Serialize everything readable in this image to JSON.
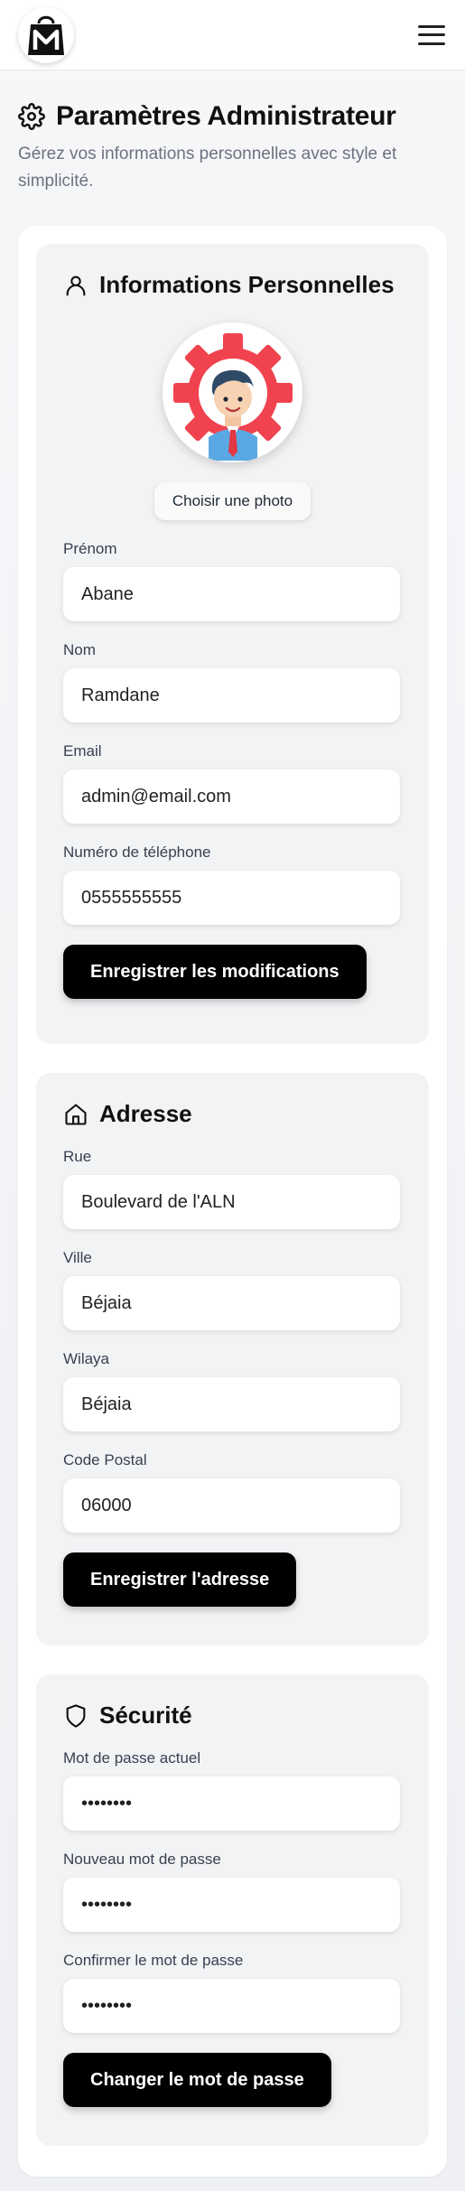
{
  "header": {
    "logo_icon": "shopping-bag-logo-icon",
    "menu_icon": "hamburger-menu-icon"
  },
  "page": {
    "title": "Paramètres Administrateur",
    "subtitle": "Gérez vos informations personnelles avec style et simplicité.",
    "title_icon": "gear-icon"
  },
  "personal": {
    "title": "Informations Personnelles",
    "icon": "user-icon",
    "photo_button": "Choisir une photo",
    "first_name_label": "Prénom",
    "first_name_value": "Abane",
    "last_name_label": "Nom",
    "last_name_value": "Ramdane",
    "email_label": "Email",
    "email_value": "admin@email.com",
    "phone_label": "Numéro de téléphone",
    "phone_value": "0555555555",
    "save_button": "Enregistrer les modifications"
  },
  "address": {
    "title": "Adresse",
    "icon": "home-icon",
    "street_label": "Rue",
    "street_value": "Boulevard de l'ALN",
    "city_label": "Ville",
    "city_value": "Béjaia",
    "wilaya_label": "Wilaya",
    "wilaya_value": "Béjaia",
    "postal_label": "Code Postal",
    "postal_value": "06000",
    "save_button": "Enregistrer l'adresse"
  },
  "security": {
    "title": "Sécurité",
    "icon": "shield-icon",
    "current_label": "Mot de passe actuel",
    "current_value": "********",
    "new_label": "Nouveau mot de passe",
    "new_value": "********",
    "confirm_label": "Confirmer le mot de passe",
    "confirm_value": "********",
    "save_button": "Changer le mot de passe"
  },
  "colors": {
    "primary_button": "#000000",
    "section_bg": "#f2f3f5",
    "avatar_gear": "#f0434f"
  }
}
